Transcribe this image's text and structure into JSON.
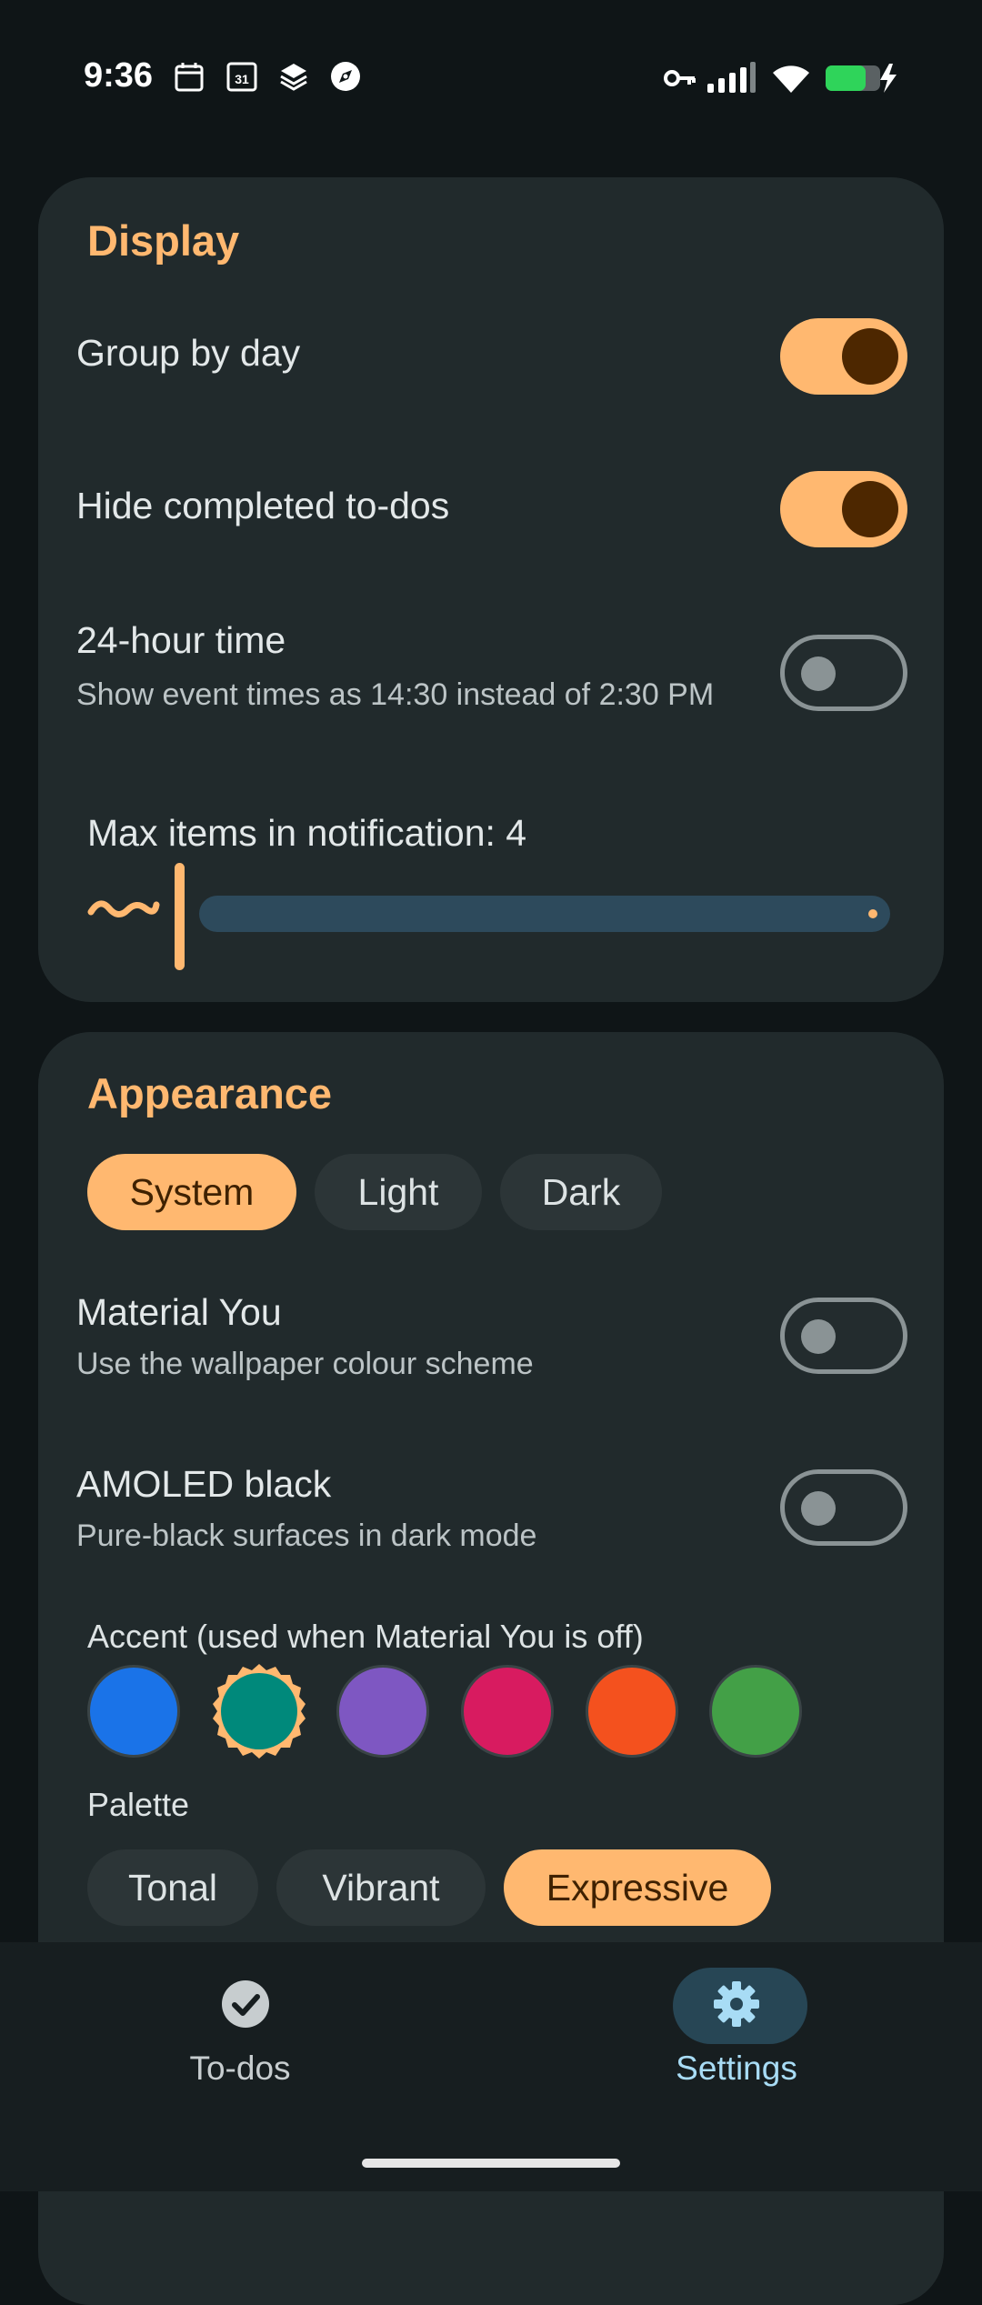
{
  "status_bar": {
    "time": "9:36",
    "left_icons": [
      "calendar-icon",
      "calendar-31-icon",
      "stack-icon",
      "compass-icon"
    ],
    "right_icons": [
      "vpn-key-icon",
      "signal-icon",
      "wifi-icon",
      "battery-charging-icon"
    ]
  },
  "display": {
    "title": "Display",
    "group_by_day": {
      "label": "Group by day",
      "on": true
    },
    "hide_completed": {
      "label": "Hide completed to-dos",
      "on": true
    },
    "hour24": {
      "label": "24-hour time",
      "sub": "Show event times as 14:30 instead of 2:30 PM",
      "on": false
    },
    "max_items": {
      "label": "Max items in notification: 4",
      "value": 4
    }
  },
  "appearance": {
    "title": "Appearance",
    "theme_options": [
      "System",
      "Light",
      "Dark"
    ],
    "theme_selected": "System",
    "material_you": {
      "label": "Material You",
      "sub": "Use the wallpaper colour scheme",
      "on": false
    },
    "amoled": {
      "label": "AMOLED black",
      "sub": "Pure-black surfaces in dark mode",
      "on": false
    },
    "accent_label": "Accent (used when Material You is off)",
    "accent_colors": [
      "#1a73e8",
      "#00897b",
      "#7e57c2",
      "#d81b60",
      "#f4511e",
      "#43a047"
    ],
    "accent_selected": "#00897b",
    "palette_label": "Palette",
    "palette_options": [
      "Tonal",
      "Vibrant",
      "Expressive"
    ],
    "palette_selected": "Expressive"
  },
  "bottom_nav": {
    "items": [
      {
        "label": "To-dos",
        "icon": "check-circle-icon",
        "active": false
      },
      {
        "label": "Settings",
        "icon": "gear-icon",
        "active": true
      }
    ]
  },
  "colors": {
    "accent": "#ffb870",
    "card": "#212a2c",
    "background": "#0f1517"
  }
}
